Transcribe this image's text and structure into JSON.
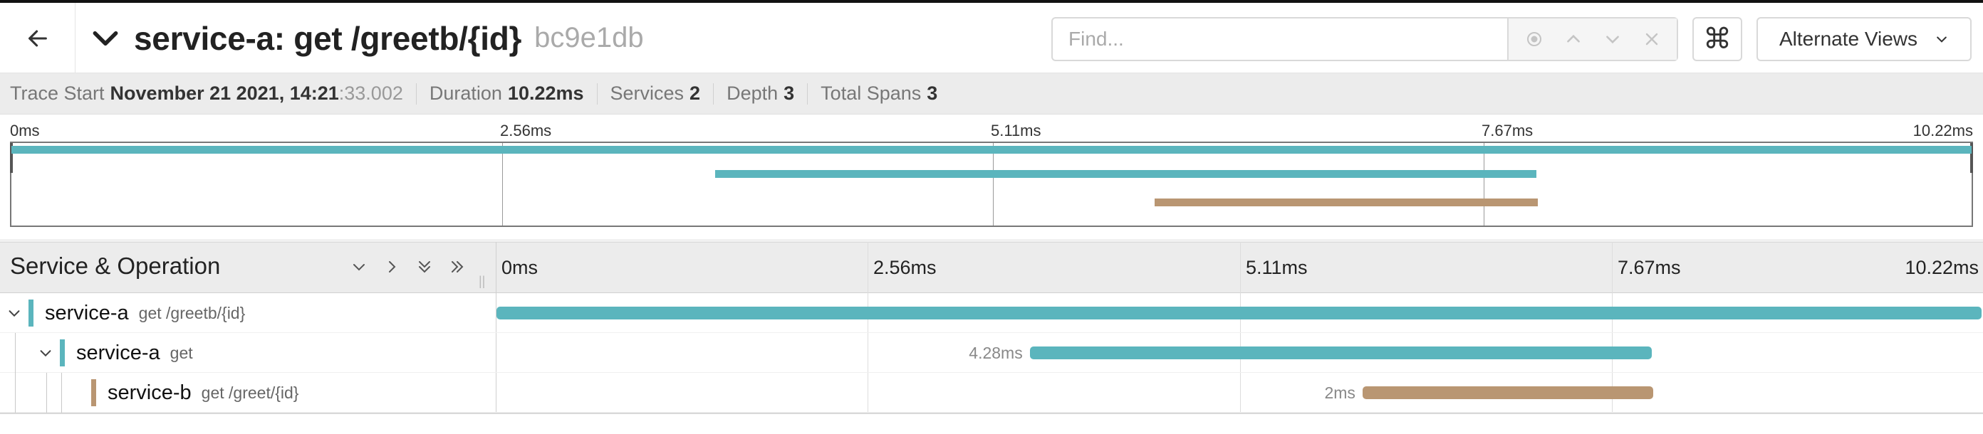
{
  "header": {
    "title": "service-a: get /greetb/{id}",
    "trace_id": "bc9e1db",
    "find_placeholder": "Find...",
    "alternate_views_label": "Alternate Views"
  },
  "summary": {
    "trace_start_label": "Trace Start",
    "trace_start_value": "November 21 2021, 14:21",
    "trace_start_secs": ":33.002",
    "duration_label": "Duration",
    "duration_value": "10.22ms",
    "services_label": "Services",
    "services_value": "2",
    "depth_label": "Depth",
    "depth_value": "3",
    "total_spans_label": "Total Spans",
    "total_spans_value": "3"
  },
  "minimap": {
    "ticks": [
      "0ms",
      "2.56ms",
      "5.11ms",
      "7.67ms",
      "10.22ms"
    ]
  },
  "timeline": {
    "column_title": "Service & Operation",
    "ticks": [
      "0ms",
      "2.56ms",
      "5.11ms",
      "7.67ms",
      "10.22ms"
    ],
    "total_ms": 10.22,
    "spans": [
      {
        "service": "service-a",
        "operation": "get /greetb/{id}",
        "start_ms": 0,
        "duration_ms": 10.22,
        "duration_label": "",
        "color": "#5bb5bd",
        "depth": 0,
        "expandable": true
      },
      {
        "service": "service-a",
        "operation": "get",
        "start_ms": 3.67,
        "duration_ms": 4.28,
        "duration_label": "4.28ms",
        "color": "#5bb5bd",
        "depth": 1,
        "expandable": true
      },
      {
        "service": "service-b",
        "operation": "get /greet/{id}",
        "start_ms": 5.96,
        "duration_ms": 2.0,
        "duration_label": "2ms",
        "color": "#b99672",
        "depth": 2,
        "expandable": false
      }
    ]
  },
  "colors": {
    "service_a": "#5bb5bd",
    "service_b": "#b99672"
  },
  "icons": [
    "arrow-left-icon",
    "chevron-down-icon",
    "target-icon",
    "chevron-up-icon",
    "close-icon",
    "command-key-icon",
    "double-chevron-down-icon",
    "double-chevron-right-icon",
    "chevron-right-icon"
  ]
}
